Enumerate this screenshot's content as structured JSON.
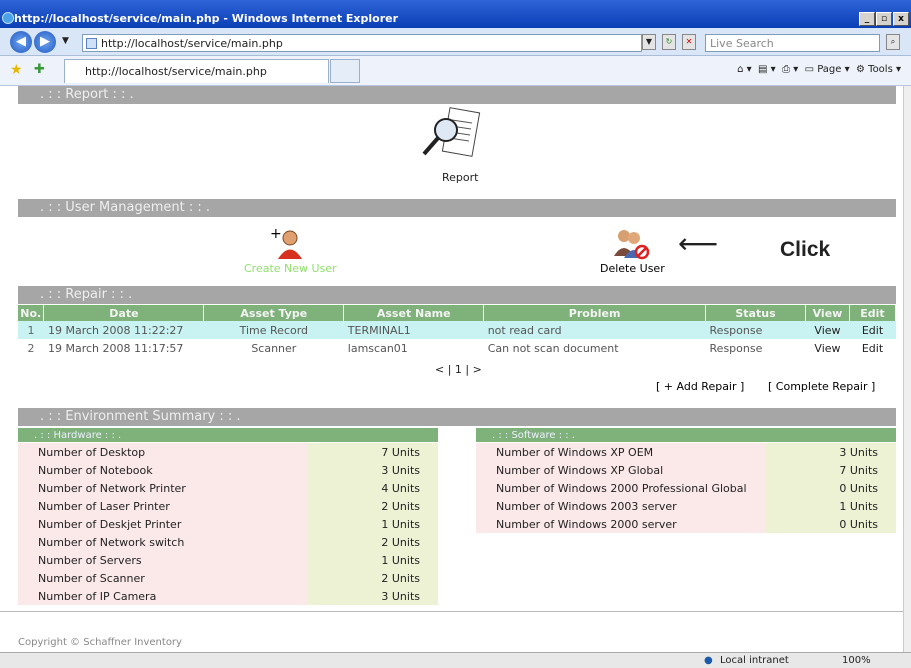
{
  "window": {
    "title": "http://localhost/service/main.php - Windows Internet Explorer",
    "min": "_",
    "max": "▫",
    "close": "x"
  },
  "address": {
    "url": "http://localhost/service/main.php",
    "search_placeholder": "Live Search"
  },
  "tab": {
    "label": "http://localhost/service/main.php"
  },
  "toolbar": {
    "page": "Page",
    "tools": "Tools"
  },
  "sections": {
    "report": ". : : Report : : .",
    "user_mgmt": ". : : User Management : : .",
    "repair": ". : : Repair : : .",
    "env": ". : : Environment Summary : : ."
  },
  "report": {
    "label": "Report"
  },
  "users": {
    "create": "Create New User",
    "delete": "Delete User"
  },
  "annotation": {
    "arrow": "⟵",
    "text": "Click"
  },
  "repair": {
    "headers": [
      "No.",
      "Date",
      "Asset Type",
      "Asset Name",
      "Problem",
      "Status",
      "View",
      "Edit"
    ],
    "rows": [
      {
        "no": "1",
        "date": "19 March 2008 11:22:27",
        "type": "Time Record",
        "name": "TERMINAL1",
        "problem": "not read card",
        "status": "Response",
        "view": "View",
        "edit": "Edit"
      },
      {
        "no": "2",
        "date": "19 March 2008 11:17:57",
        "type": "Scanner",
        "name": "lamscan01",
        "problem": "Can not scan document",
        "status": "Response",
        "view": "View",
        "edit": "Edit"
      }
    ],
    "pager": "< | 1 | >",
    "add": "[ + Add Repair ]",
    "complete": "[ Complete Repair ]"
  },
  "hardware": {
    "title": ". : : Hardware : : .",
    "rows": [
      {
        "label": "Number of Desktop",
        "value": "7 Units"
      },
      {
        "label": "Number of Notebook",
        "value": "3 Units"
      },
      {
        "label": "Number of Network Printer",
        "value": "4 Units"
      },
      {
        "label": "Number of Laser Printer",
        "value": "2 Units"
      },
      {
        "label": "Number of Deskjet Printer",
        "value": "1 Units"
      },
      {
        "label": "Number of Network switch",
        "value": "2 Units"
      },
      {
        "label": "Number of Servers",
        "value": "1 Units"
      },
      {
        "label": "Number of Scanner",
        "value": "2 Units"
      },
      {
        "label": "Number of IP Camera",
        "value": "3 Units"
      }
    ]
  },
  "software": {
    "title": ". : : Software : : .",
    "rows": [
      {
        "label": "Number of Windows XP OEM",
        "value": "3 Units"
      },
      {
        "label": "Number of Windows XP Global",
        "value": "7 Units"
      },
      {
        "label": "Number of Windows 2000 Professional Global",
        "value": "0 Units"
      },
      {
        "label": "Number of Windows 2003 server",
        "value": "1 Units"
      },
      {
        "label": "Number of Windows 2000 server",
        "value": "0 Units"
      }
    ]
  },
  "footer": {
    "copyright": "Copyright © Schaffner Inventory"
  },
  "statusbar": {
    "zone": "Local intranet",
    "zoom": "100%"
  }
}
